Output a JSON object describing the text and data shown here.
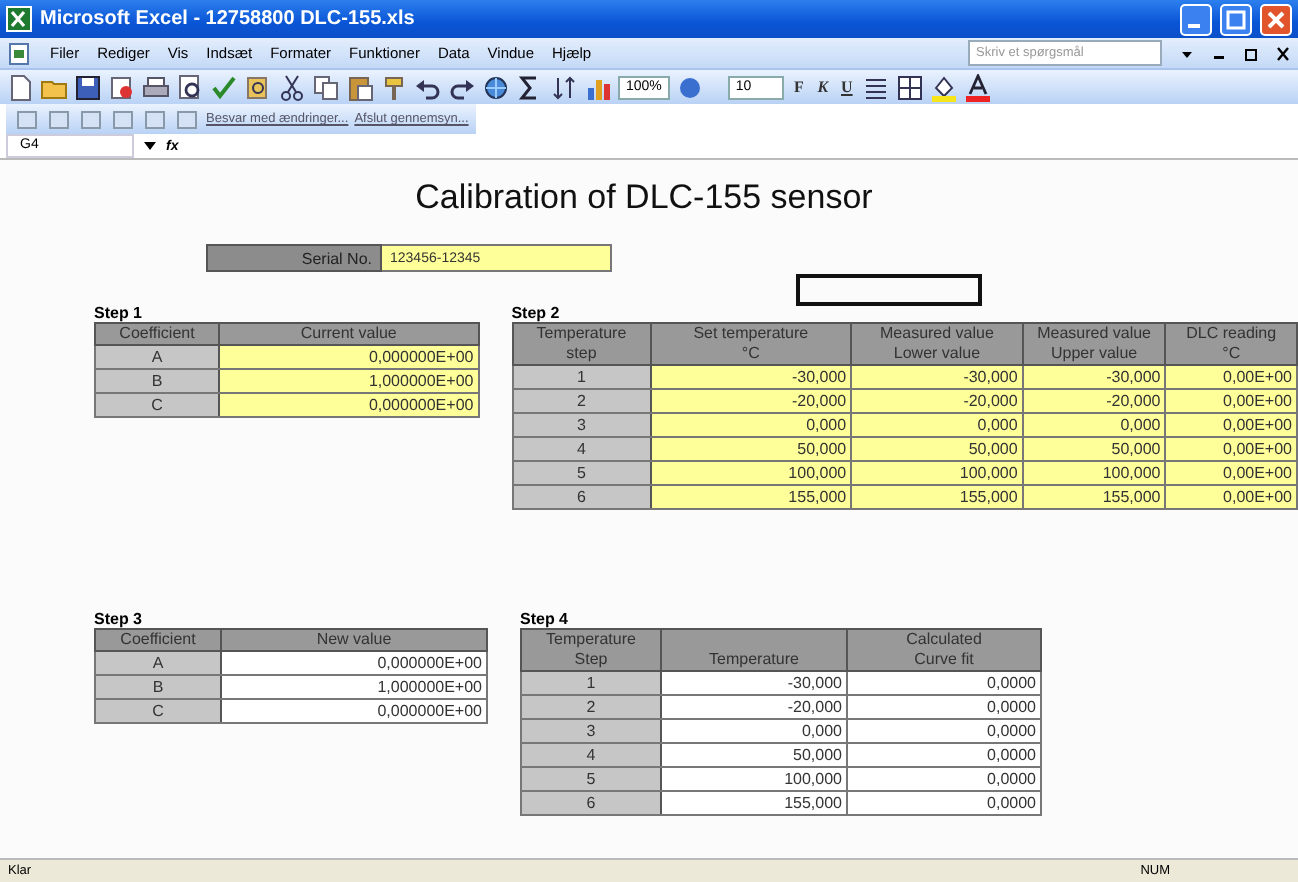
{
  "window": {
    "title": "Microsoft Excel - 12758800 DLC-155.xls"
  },
  "menu": {
    "items": [
      "Filer",
      "Rediger",
      "Vis",
      "Indsæt",
      "Formater",
      "Funktioner",
      "Data",
      "Vindue",
      "Hjælp"
    ],
    "help_placeholder": "Skriv et spørgsmål"
  },
  "toolbar": {
    "zoom": "100%",
    "font_size": "10",
    "format_buttons": [
      "F",
      "K",
      "U"
    ]
  },
  "review_toolbar": {
    "items": [
      "Besvar med ændringer...",
      "Afslut gennemsyn..."
    ]
  },
  "formula_bar": {
    "cell": "G4",
    "fx": "fx"
  },
  "sheet": {
    "title": "Calibration of DLC-155 sensor",
    "serial_label": "Serial No.",
    "serial_value": "123456-12345",
    "tables": [
      {
        "heading": "Step 1",
        "kind": "input",
        "columns": [
          "Coefficient",
          "Current value"
        ],
        "rows": [
          [
            "A",
            "0,000000E+00"
          ],
          [
            "B",
            "1,000000E+00"
          ],
          [
            "C",
            "0,000000E+00"
          ]
        ]
      },
      {
        "heading": "Step 2",
        "kind": "input",
        "columns": [
          "Temperature\nstep",
          "Set temperature\n°C",
          "Measured value\nLower value",
          "Measured value\nUpper value",
          "DLC reading\n°C"
        ],
        "rows": [
          [
            "1",
            "-30,000",
            "-30,000",
            "-30,000",
            "0,00E+00"
          ],
          [
            "2",
            "-20,000",
            "-20,000",
            "-20,000",
            "0,00E+00"
          ],
          [
            "3",
            "0,000",
            "0,000",
            "0,000",
            "0,00E+00"
          ],
          [
            "4",
            "50,000",
            "50,000",
            "50,000",
            "0,00E+00"
          ],
          [
            "5",
            "100,000",
            "100,000",
            "100,000",
            "0,00E+00"
          ],
          [
            "6",
            "155,000",
            "155,000",
            "155,000",
            "0,00E+00"
          ]
        ]
      },
      {
        "heading": "Step 3",
        "kind": "output",
        "columns": [
          "Coefficient",
          "New value"
        ],
        "rows": [
          [
            "A",
            "0,000000E+00"
          ],
          [
            "B",
            "1,000000E+00"
          ],
          [
            "C",
            "0,000000E+00"
          ]
        ]
      },
      {
        "heading": "Step 4",
        "kind": "output",
        "columns": [
          "Temperature\nStep",
          "\nTemperature",
          "Calculated\nCurve fit"
        ],
        "rows": [
          [
            "1",
            "-30,000",
            "0,0000"
          ],
          [
            "2",
            "-20,000",
            "0,0000"
          ],
          [
            "3",
            "0,000",
            "0,0000"
          ],
          [
            "4",
            "50,000",
            "0,0000"
          ],
          [
            "5",
            "100,000",
            "0,0000"
          ],
          [
            "6",
            "155,000",
            "0,0000"
          ]
        ]
      }
    ]
  },
  "status_bar": {
    "status": "Klar",
    "indicator": "NUM"
  }
}
